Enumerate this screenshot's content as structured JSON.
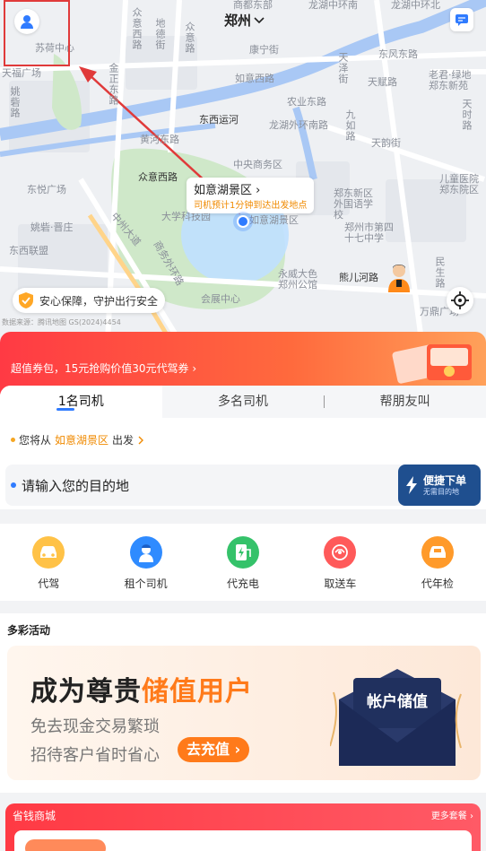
{
  "map": {
    "city": "郑州",
    "pickup_title": "如意湖景区",
    "pickup_hint": "司机预计1分钟到达出发地点",
    "safety_text": "安心保障，守护出行安全",
    "copyright": "数据来源：腾讯地图 GS(2024)4454",
    "labels": {
      "l1": "苏荷中心",
      "l2": "天福广场",
      "l3": "姚砦路",
      "l4": "众意西路",
      "l5": "地德街",
      "l6": "众意路",
      "l7": "康宁街",
      "l8": "金正东路",
      "l9": "东风东路",
      "l10": "如意西路",
      "l11": "天泽街",
      "l12": "天赋路",
      "l13": "老君·绿地郑东新苑",
      "l14": "农业东路",
      "l15": "东西运河",
      "l16": "龙湖外环南路",
      "l17": "九如路",
      "l18": "天韵街",
      "l19": "天时路",
      "l20": "黄河东路",
      "l21": "中央商务区",
      "l22": "众意西路",
      "l23": "东悦广场",
      "l24": "儿童医院郑东院区",
      "l25": "郑东新区外国语学校",
      "l26": "郑州市第四十七中学",
      "l27": "姚砦·晋庄",
      "l28": "中州大道",
      "l29": "东西联盟",
      "l30": "商务外环路",
      "l31": "永威大色郑州公馆",
      "l32": "熊儿河路",
      "l33": "民生路",
      "l34": "会展中心",
      "l35": "万鼎广场",
      "l36": "龙湖中环南",
      "l37": "龙湖中环北",
      "l38": "商都东部",
      "l39": "如意湖景区",
      "l40": "大学科技园"
    }
  },
  "promo": {
    "text": "超值券包，15元抢购价值30元代驾券 ›"
  },
  "order": {
    "tabs": [
      "1名司机",
      "多名司机",
      "帮朋友叫"
    ],
    "from_prefix": "您将从",
    "from_place": "如意湖景区",
    "from_suffix": "出发",
    "dest_placeholder": "请输入您的目的地",
    "quick_title": "便捷下单",
    "quick_sub": "无需目的地"
  },
  "services": [
    {
      "label": "代驾",
      "icon": "car-icon",
      "color": "#ffb432"
    },
    {
      "label": "租个司机",
      "icon": "driver-icon",
      "color": "#2f8bff"
    },
    {
      "label": "代充电",
      "icon": "charging-icon",
      "color": "#35c26a"
    },
    {
      "label": "取送车",
      "icon": "car-pickup-icon",
      "color": "#ff5a5a"
    },
    {
      "label": "代年检",
      "icon": "inspection-icon",
      "color": "#ff9a2a"
    }
  ],
  "activities": {
    "title": "多彩活动",
    "banner_h1_a": "成为尊贵",
    "banner_h1_b": "储值用户",
    "banner_s1": "免去现金交易繁琐",
    "banner_s2": "招待客户省时省心",
    "banner_btn": "去充值 ›",
    "envelope_text": "帐户储值"
  },
  "mall": {
    "title": "省钱商城",
    "more": "更多套餐 ›"
  }
}
